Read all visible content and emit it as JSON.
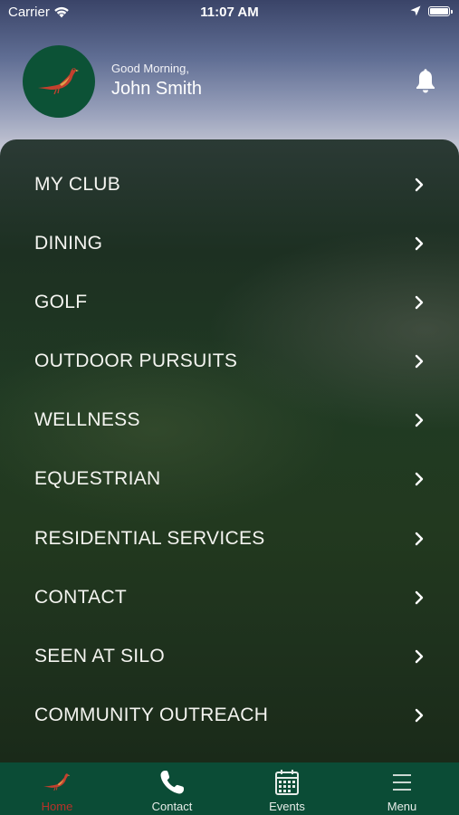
{
  "status_bar": {
    "carrier": "Carrier",
    "time": "11:07 AM"
  },
  "header": {
    "greeting": "Good Morning,",
    "user_name": "John Smith",
    "avatar_icon": "pheasant-logo-icon",
    "notification_icon": "bell-icon"
  },
  "menu": {
    "items": [
      {
        "label": "MY CLUB"
      },
      {
        "label": "DINING"
      },
      {
        "label": "GOLF"
      },
      {
        "label": "OUTDOOR PURSUITS"
      },
      {
        "label": "WELLNESS"
      },
      {
        "label": "EQUESTRIAN"
      },
      {
        "label": "RESIDENTIAL SERVICES"
      },
      {
        "label": "CONTACT"
      },
      {
        "label": "SEEN AT SILO"
      },
      {
        "label": "COMMUNITY OUTREACH"
      }
    ],
    "chevron_icon": "chevron-right-icon"
  },
  "tab_bar": {
    "tabs": [
      {
        "label": "Home",
        "icon": "pheasant-icon",
        "active": true
      },
      {
        "label": "Contact",
        "icon": "phone-icon",
        "active": false
      },
      {
        "label": "Events",
        "icon": "calendar-icon",
        "active": false
      },
      {
        "label": "Menu",
        "icon": "hamburger-icon",
        "active": false
      }
    ]
  },
  "colors": {
    "brand_green": "#0b4c36",
    "active_tab": "#b8322a",
    "avatar_bg": "#0c5236"
  }
}
